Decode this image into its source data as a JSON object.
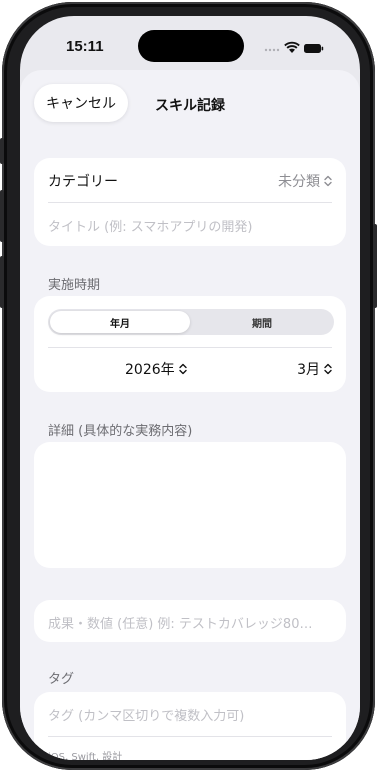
{
  "status": {
    "time": "15:11"
  },
  "nav": {
    "cancel": "キャンセル",
    "title": "スキル記録"
  },
  "category": {
    "label": "カテゴリー",
    "value": "未分類",
    "icon": "chevron-up-down-icon"
  },
  "title_field": {
    "placeholder": "タイトル (例: スマホアプリの開発)"
  },
  "period": {
    "header": "実施時期",
    "segments": [
      "年月",
      "期間"
    ],
    "selected_segment": "年月",
    "year": "2026年",
    "month": "3月"
  },
  "detail": {
    "header": "詳細 (具体的な実務内容)"
  },
  "result_field": {
    "placeholder": "成果・数値 (任意) 例: テストカバレッジ80…"
  },
  "tags": {
    "header": "タグ",
    "placeholder": "タグ (カンマ区切りで複数入力可)",
    "example": "iOS, Swift, 設計"
  }
}
